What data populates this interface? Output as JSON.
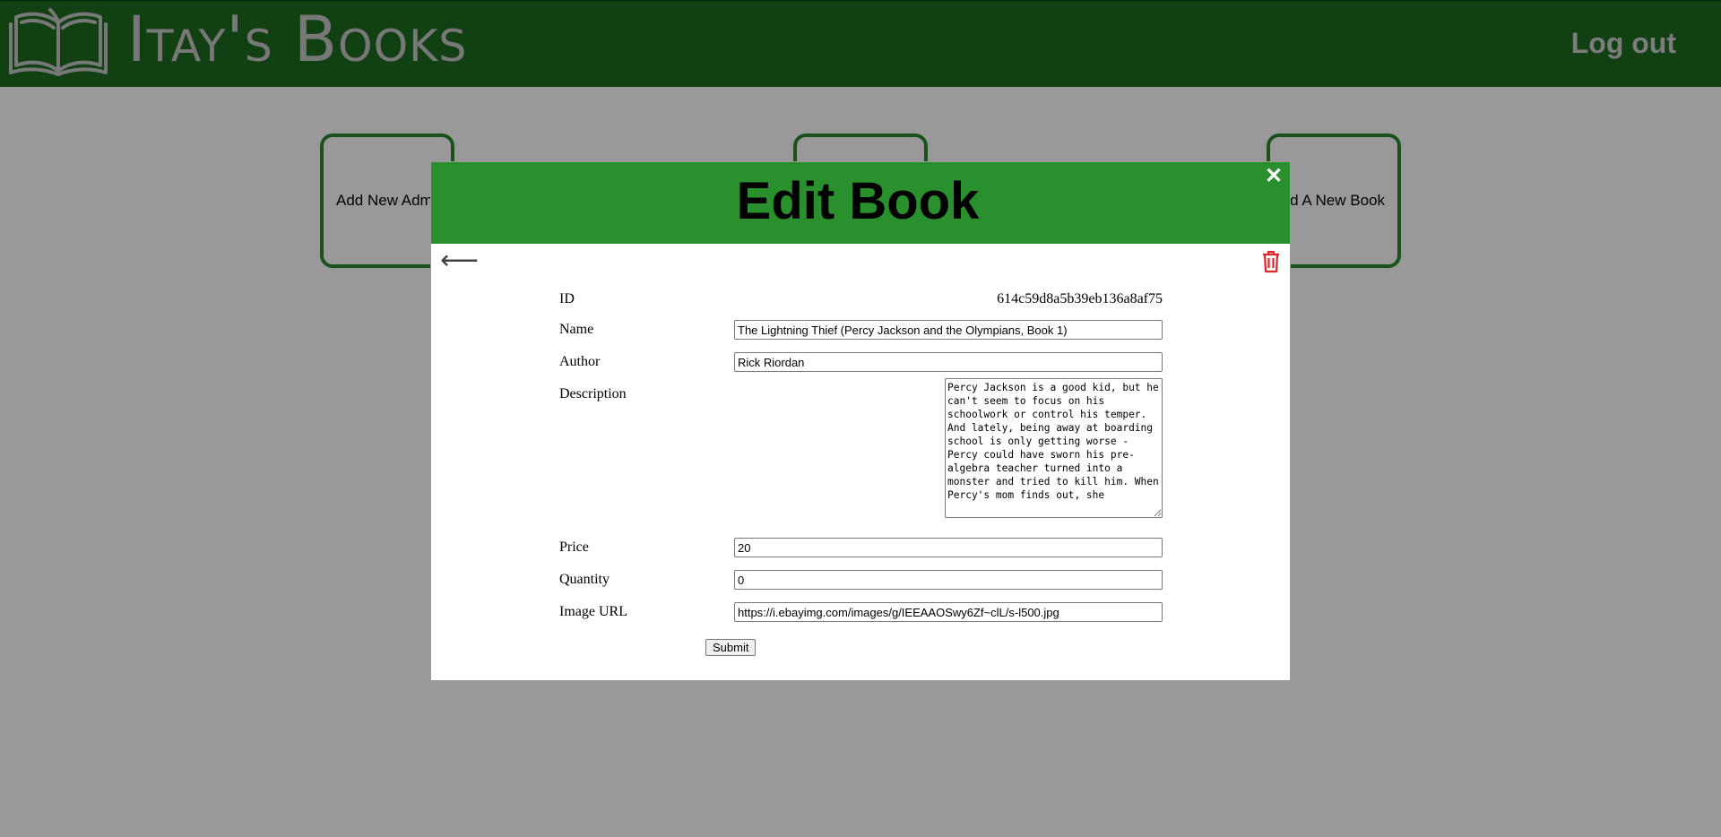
{
  "header": {
    "brand": "Itay's Books",
    "logout_label": "Log out"
  },
  "cards": [
    {
      "label": "Add New Admin"
    },
    {
      "label": ""
    },
    {
      "label": "Add A New Book"
    }
  ],
  "modal": {
    "title": "Edit Book",
    "close_glyph": "✕",
    "back_glyph": "⟵",
    "form": {
      "id_label": "ID",
      "id_value": "614c59d8a5b39eb136a8af75",
      "name_label": "Name",
      "name_value": "The Lightning Thief (Percy Jackson and the Olympians, Book 1)",
      "author_label": "Author",
      "author_value": "Rick Riordan",
      "description_label": "Description",
      "description_value": "Percy Jackson is a good kid, but he can't seem to focus on his schoolwork or control his temper. And lately, being away at boarding school is only getting worse - Percy could have sworn his pre-algebra teacher turned into a monster and tried to kill him. When Percy's mom finds out, she",
      "price_label": "Price",
      "price_value": "20",
      "quantity_label": "Quantity",
      "quantity_value": "0",
      "image_url_label": "Image URL",
      "image_url_value": "https://i.ebayimg.com/images/g/IEEAAOSwy6Zf~clL/s-l500.jpg",
      "submit_label": "Submit"
    }
  },
  "colors": {
    "header_bg": "#1d6b21",
    "modal_head_bg": "#2a8f2d",
    "card_border": "#2a8a2d",
    "trash_color": "#e0242a"
  },
  "icons": {
    "logo": "open-book-icon",
    "close": "close-icon",
    "back": "back-arrow-icon",
    "delete": "trash-icon"
  }
}
